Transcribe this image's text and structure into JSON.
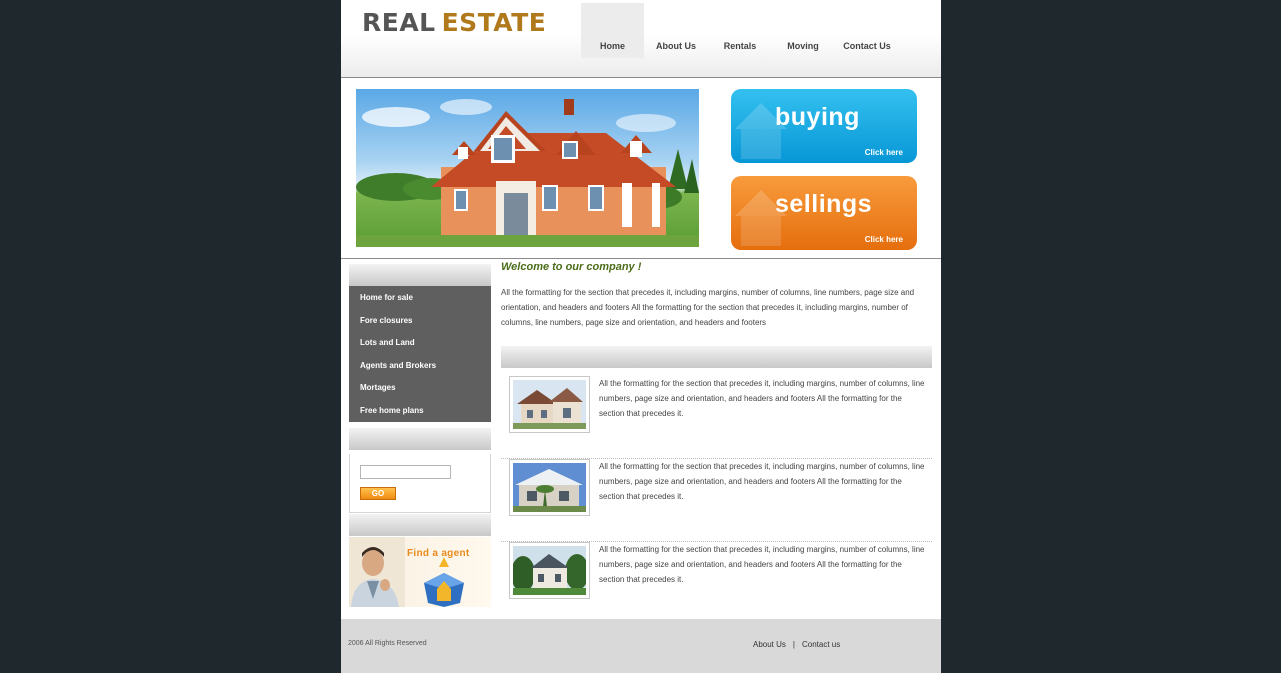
{
  "header": {
    "logo_part1": "REAL",
    "logo_part2": "ESTATE",
    "nav": [
      {
        "label": "Home",
        "active": true
      },
      {
        "label": "About Us"
      },
      {
        "label": "Rentals"
      },
      {
        "label": "Moving"
      },
      {
        "label": "Contact Us"
      }
    ]
  },
  "promos": {
    "buying": {
      "title": "buying",
      "cta": "Click here"
    },
    "selling": {
      "title": "sellings",
      "cta": "Click here"
    }
  },
  "sidebar": {
    "menu": [
      "Home for sale",
      "Fore closures",
      "Lots and Land",
      "Agents and Brokers",
      "Mortages",
      "Free home plans"
    ],
    "search": {
      "value": "",
      "placeholder": "",
      "button": "GO"
    },
    "agent_banner": "Find a agent"
  },
  "main": {
    "welcome": "Welcome to our company  !",
    "intro": "All the formatting for the section that precedes it, including margins, number of columns, line numbers, page size and orientation, and headers and footers All the formatting for the section that precedes it, including margins, number of columns, line numbers, page size and orientation, and headers and footers",
    "listings": [
      {
        "text": "All the formatting for the section that precedes it, including margins, number of columns, line numbers, page size and orientation, and headers and footers All the formatting for the section that precedes it."
      },
      {
        "text": "All the formatting for the section that precedes it, including margins, number of columns, line numbers, page size and orientation, and headers and footers All the formatting for the section that precedes it."
      },
      {
        "text": "All the formatting for the section that precedes it, including margins, number of columns, line numbers, page size and orientation, and headers and footers All the formatting for the section that precedes it."
      }
    ]
  },
  "footer": {
    "copyright": "2006 All Rights Reserved",
    "links": [
      "About Us",
      "Contact us"
    ],
    "separator": "|"
  },
  "colors": {
    "background": "#1e282d",
    "logo_accent": "#b07a1c",
    "buying": "#0797d6",
    "selling": "#e56e0d",
    "menu_bg": "#5f5f5f",
    "welcome": "#4c6d1a"
  }
}
